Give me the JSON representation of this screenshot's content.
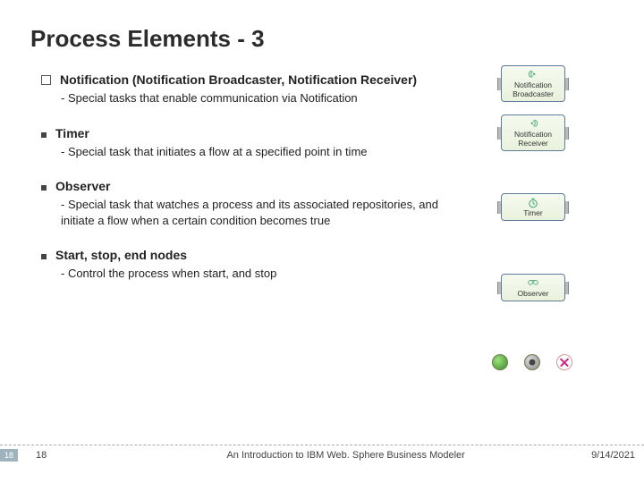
{
  "title": "Process Elements - 3",
  "items": [
    {
      "bullet": "checkbox",
      "heading": "Notification (Notification Broadcaster, Notification Receiver)",
      "sub": "-  Special tasks that enable communication via Notification"
    },
    {
      "bullet": "square",
      "heading": "Timer",
      "sub": "- Special task that initiates a flow at a specified point in time"
    },
    {
      "bullet": "square",
      "heading": "Observer",
      "sub": "- Special task that watches a process and its associated repositories, and initiate a flow when a certain condition becomes true"
    },
    {
      "bullet": "square",
      "heading": "Start, stop, end nodes",
      "sub": "- Control the process when start, and stop"
    }
  ],
  "visuals": {
    "broadcaster_label": "Notification Broadcaster",
    "receiver_label": "Notification Receiver",
    "timer_label": "Timer",
    "observer_label": "Observer"
  },
  "footer": {
    "page_badge": "18",
    "page_num": "18",
    "title": "An Introduction to IBM Web. Sphere Business Modeler",
    "date": "9/14/2021"
  }
}
